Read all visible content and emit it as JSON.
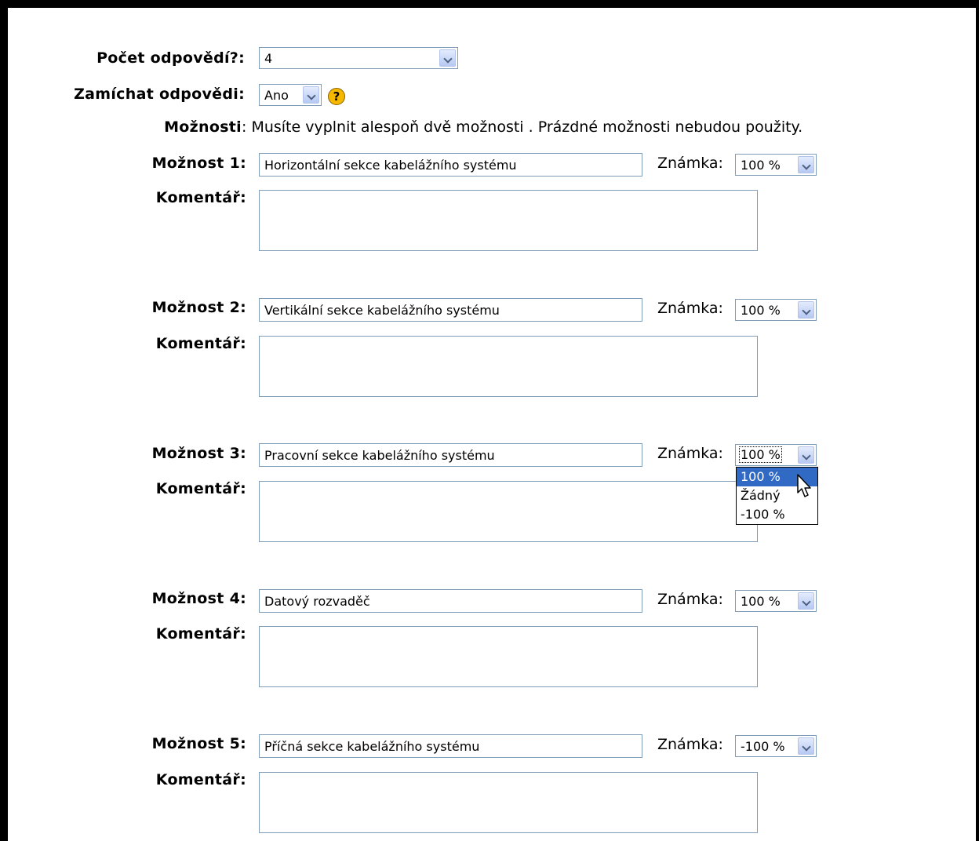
{
  "form": {
    "answer_count": {
      "label": "Počet odpovědí?:",
      "value": "4"
    },
    "shuffle": {
      "label": "Zamíchat odpovědi:",
      "value": "Ano"
    },
    "choices_heading": {
      "label": "Možnosti",
      "text": ": Musíte vyplnit alespoň dvě možnosti . Prázdné možnosti nebudou použity."
    },
    "options": [
      {
        "label": "Možnost 1:",
        "value": "Horizontální sekce kabelážního systému",
        "grade_label": "Známka:",
        "grade": "100 %",
        "comment_label": "Komentář:"
      },
      {
        "label": "Možnost 2:",
        "value": "Vertikální sekce kabelážního systému",
        "grade_label": "Známka:",
        "grade": "100 %",
        "comment_label": "Komentář:"
      },
      {
        "label": "Možnost 3:",
        "value": "Pracovní sekce kabelážního systému",
        "grade_label": "Známka:",
        "grade": "100 %",
        "comment_label": "Komentář:"
      },
      {
        "label": "Možnost 4:",
        "value": "Datový rozvaděč",
        "grade_label": "Známka:",
        "grade": "100 %",
        "comment_label": "Komentář:"
      },
      {
        "label": "Možnost 5:",
        "value": "Příčná sekce kabelážního systému",
        "grade_label": "Známka:",
        "grade": "-100 %",
        "comment_label": "Komentář:"
      }
    ],
    "grade_dropdown_options": [
      "100 %",
      "Žádný",
      "-100 %"
    ]
  },
  "colors": {
    "selection": "#316ac5",
    "input_border": "#7f9db9",
    "help_icon": "#f5b800"
  },
  "icons": {
    "help": "help-icon",
    "cursor": "mouse-pointer-icon"
  }
}
